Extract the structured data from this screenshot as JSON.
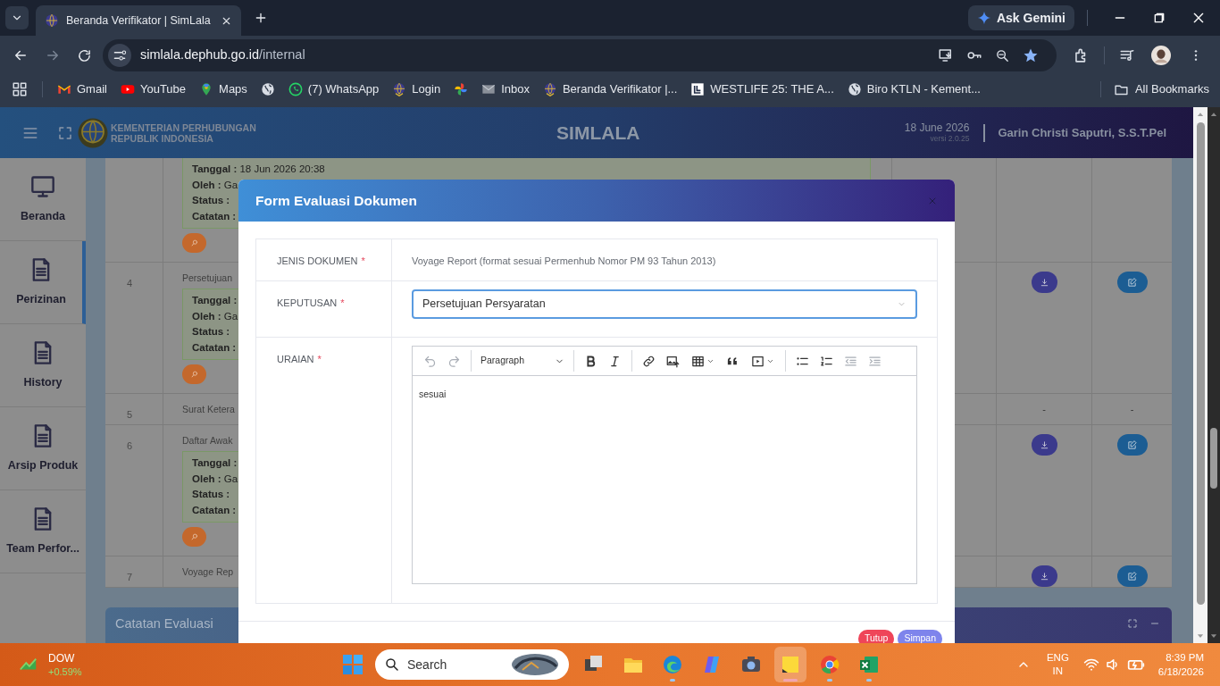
{
  "browser": {
    "tabs": [
      {
        "title": "Beranda Verifikator | SimLala",
        "selected": true
      }
    ],
    "ask_gemini": "Ask Gemini",
    "url_host": "simlala.dephub.go.id",
    "url_path": "/internal",
    "bookmarks": [
      {
        "kind": "gmail",
        "label": "Gmail"
      },
      {
        "kind": "youtube",
        "label": "YouTube"
      },
      {
        "kind": "maps",
        "label": "Maps"
      },
      {
        "kind": "globe"
      },
      {
        "kind": "whatsapp",
        "label": "(7) WhatsApp"
      },
      {
        "kind": "emblem",
        "label": "Login"
      },
      {
        "kind": "pinwheel"
      },
      {
        "kind": "mail",
        "label": "Inbox"
      },
      {
        "kind": "emblem",
        "label": "Beranda Verifikator |..."
      },
      {
        "kind": "square-logo",
        "label": "WESTLIFE 25: THE A..."
      },
      {
        "kind": "globe",
        "label": "Biro KTLN - Kement..."
      }
    ],
    "all_bookmarks": "All Bookmarks"
  },
  "app": {
    "org_line_1": "KEMENTERIAN PERHUBUNGAN",
    "org_line_2": "REPUBLIK INDONESIA",
    "title": "SIMLALA",
    "date": "18 June 2026",
    "version": "versi 2.0.25",
    "user": "Garin Christi Saputri, S.S.T.Pel"
  },
  "sidebar": [
    {
      "label": "Beranda",
      "kind": "monitor",
      "selected": false
    },
    {
      "label": "Perizinan",
      "kind": "document",
      "selected": true
    },
    {
      "label": "History",
      "kind": "document",
      "selected": false
    },
    {
      "label": "Arsip Produk",
      "kind": "document",
      "selected": false
    },
    {
      "label": "Team Perfor...",
      "kind": "document",
      "selected": false
    }
  ],
  "table": {
    "rows": [
      {
        "evaluation": [
          "**Tanggal :** 18 Jun 2026 20:38",
          "**Oleh :** Ga",
          "**Status :**",
          "**Catatan :**"
        ],
        "actions": {
          "kind": "none"
        }
      },
      {
        "no": "4",
        "document": "Persetujuan",
        "evaluation": [
          "**Tanggal :**",
          "**Oleh :** Ga",
          "**Status :**",
          "**Catatan :**"
        ],
        "actions": {
          "kind": "buttons"
        }
      },
      {
        "no": "5",
        "document": "Surat Ketera",
        "actions": {
          "kind": "dash",
          "values": [
            "-",
            "-"
          ]
        }
      },
      {
        "no": "6",
        "document": "Daftar Awak",
        "evaluation": [
          "**Tanggal :**",
          "**Oleh :** Ga",
          "**Status :**",
          "**Catatan :**"
        ],
        "actions": {
          "kind": "buttons"
        }
      },
      {
        "no": "7",
        "document": "Voyage Rep",
        "actions": {
          "kind": "buttons"
        }
      }
    ]
  },
  "panel": {
    "title": "Catatan Evaluasi"
  },
  "modal": {
    "title": "Form Evaluasi Dokumen",
    "fields": [
      {
        "kind": "text",
        "label": "JENIS DOKUMEN",
        "required_mark": "*",
        "value": "Voyage Report (format sesuai Permenhub Nomor PM 93 Tahun 2013)"
      },
      {
        "kind": "select",
        "label": "KEPUTUSAN",
        "required_mark": "*",
        "value": "Persetujuan Persyaratan",
        "focused": true
      },
      {
        "kind": "editor",
        "label": "URAIAN",
        "required_mark": "*",
        "heading_style": "Paragraph",
        "content": "sesuai",
        "toolbar": [
          {
            "kind": "undo",
            "disabled": true
          },
          {
            "kind": "redo",
            "disabled": true
          },
          {
            "kind": "sep"
          },
          {
            "kind": "heading"
          },
          {
            "kind": "sep"
          },
          {
            "kind": "bold",
            "disabled": false
          },
          {
            "kind": "italic",
            "disabled": false
          },
          {
            "kind": "sep"
          },
          {
            "kind": "link",
            "disabled": false
          },
          {
            "kind": "image",
            "disabled": false
          },
          {
            "kind": "table",
            "disabled": false
          },
          {
            "kind": "quote",
            "disabled": false
          },
          {
            "kind": "media",
            "disabled": false
          },
          {
            "kind": "sep"
          },
          {
            "kind": "bullets",
            "disabled": false
          },
          {
            "kind": "numbers",
            "disabled": false
          },
          {
            "kind": "outdent",
            "disabled": true
          },
          {
            "kind": "indent",
            "disabled": true
          }
        ]
      }
    ],
    "buttons": [
      {
        "kind": "danger",
        "label": "Tutup"
      },
      {
        "kind": "primary",
        "label": "Simpan"
      }
    ]
  },
  "taskbar": {
    "widget_name": "DOW",
    "widget_change": "+0.59%",
    "search": "Search",
    "apps": [
      {
        "kind": "task-view",
        "open": false,
        "selected": false
      },
      {
        "kind": "folder",
        "open": false,
        "selected": false
      },
      {
        "kind": "edge",
        "open": true,
        "selected": false
      },
      {
        "kind": "copilot",
        "open": false,
        "selected": false
      },
      {
        "kind": "camera",
        "open": false,
        "selected": false
      },
      {
        "kind": "notes",
        "open": true,
        "selected": true
      },
      {
        "kind": "chrome",
        "open": true,
        "selected": false
      },
      {
        "kind": "excel",
        "open": true,
        "selected": false
      }
    ],
    "language": "ENG",
    "region": "IN",
    "time": "8:39 PM",
    "date": "6/18/2026"
  }
}
